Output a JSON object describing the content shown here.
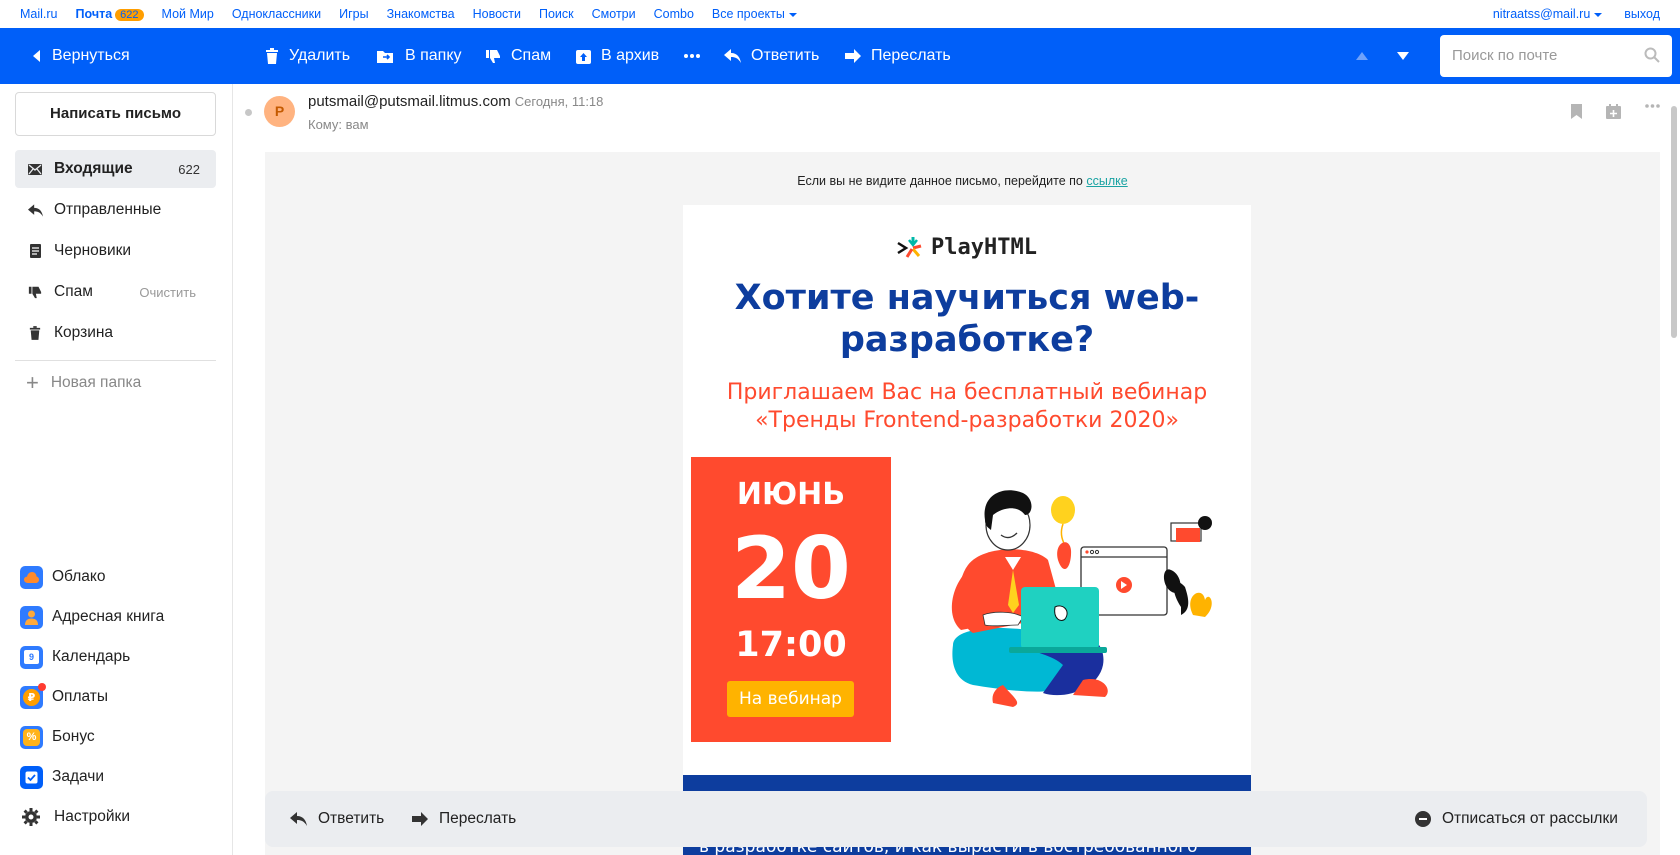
{
  "portal": {
    "links": [
      "Mail.ru",
      "Почта",
      "Мой Мир",
      "Одноклассники",
      "Игры",
      "Знакомства",
      "Новости",
      "Поиск",
      "Смотри",
      "Combo",
      "Все проекты"
    ],
    "mail_badge": "622",
    "user": "nitraatss@mail.ru",
    "logout": "выход"
  },
  "toolbar": {
    "back": "Вернуться",
    "delete": "Удалить",
    "to_folder": "В папку",
    "spam": "Спам",
    "archive": "В архив",
    "reply": "Ответить",
    "forward": "Переслать",
    "search_placeholder": "Поиск по почте"
  },
  "sidebar": {
    "compose": "Написать письмо",
    "folders": [
      {
        "label": "Входящие",
        "count": "622"
      },
      {
        "label": "Отправленные"
      },
      {
        "label": "Черновики"
      },
      {
        "label": "Спам",
        "action": "Очистить"
      },
      {
        "label": "Корзина"
      }
    ],
    "new_folder": "Новая папка",
    "services": [
      {
        "label": "Облако",
        "color": "#ff8a2b"
      },
      {
        "label": "Адресная книга",
        "color": "#ffa93a"
      },
      {
        "label": "Календарь",
        "color": "#2f7bff",
        "day": "9"
      },
      {
        "label": "Оплаты",
        "color": "#ff9e00"
      },
      {
        "label": "Бонус",
        "color": "#ffb31a"
      },
      {
        "label": "Задачи",
        "color": "#005ff9"
      }
    ],
    "settings": "Настройки"
  },
  "message": {
    "avatar_letter": "P",
    "from": "putsmail@putsmail.litmus.com",
    "time": "Сегодня, 11:18",
    "to": "Кому: вам"
  },
  "email": {
    "preheader_text": "Если вы не видите данное письмо, перейдите по",
    "preheader_link": "ссылке",
    "logo": "PlayHTML",
    "headline_1": "Хотите научиться web-",
    "headline_2": "разработке?",
    "sub_1": "Приглашаем Вас на бесплатный вебинар",
    "sub_2": "«Тренды Frontend-разработки 2020»",
    "month": "ИЮНЬ",
    "day": "20",
    "time": "17:00",
    "cta": "На вебинар",
    "band_text": "в разработке сайтов, и как вырасти в востребованного"
  },
  "bottombar": {
    "reply": "Ответить",
    "forward": "Переслать",
    "unsubscribe": "Отписаться от рассылки"
  },
  "colors": {
    "brand": "#005ff9",
    "headline": "#0d3d9e",
    "accent": "#ff4a2e",
    "cta": "#ffb300"
  }
}
